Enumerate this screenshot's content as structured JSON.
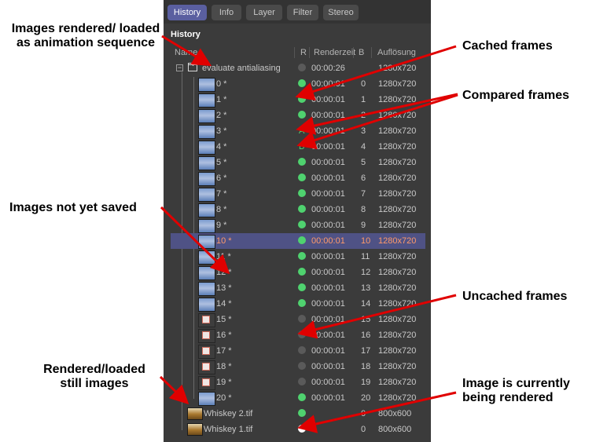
{
  "tabs": [
    {
      "label": "History",
      "active": true
    },
    {
      "label": "Info",
      "active": false
    },
    {
      "label": "Layer",
      "active": false
    },
    {
      "label": "Filter",
      "active": false
    },
    {
      "label": "Stereo",
      "active": false
    }
  ],
  "panel_title": "History",
  "columns": {
    "name": "Name",
    "r": "R",
    "renderzeit": "Renderzeit",
    "b": "B",
    "aufloesung": "Auflösung"
  },
  "group": {
    "name": "evaluate antialiasing",
    "time": "00:00:26",
    "resolution": "1280x720"
  },
  "frames": [
    {
      "name": "0 *",
      "time": "00:00:01",
      "b": "0",
      "res": "1280x720",
      "status": "cached"
    },
    {
      "name": "1 *",
      "time": "00:00:01",
      "b": "1",
      "res": "1280x720",
      "status": "cached"
    },
    {
      "name": "2 *",
      "time": "00:00:01",
      "b": "2",
      "res": "1280x720",
      "status": "cached"
    },
    {
      "name": "3 *",
      "time": "00:00:01",
      "b": "3",
      "res": "1280x720",
      "status": "compare",
      "mark": "A"
    },
    {
      "name": "4 *",
      "time": "00:00:01",
      "b": "4",
      "res": "1280x720",
      "status": "compare",
      "mark": "B"
    },
    {
      "name": "5 *",
      "time": "00:00:01",
      "b": "5",
      "res": "1280x720",
      "status": "cached"
    },
    {
      "name": "6 *",
      "time": "00:00:01",
      "b": "6",
      "res": "1280x720",
      "status": "cached"
    },
    {
      "name": "7 *",
      "time": "00:00:01",
      "b": "7",
      "res": "1280x720",
      "status": "cached"
    },
    {
      "name": "8 *",
      "time": "00:00:01",
      "b": "8",
      "res": "1280x720",
      "status": "cached"
    },
    {
      "name": "9 *",
      "time": "00:00:01",
      "b": "9",
      "res": "1280x720",
      "status": "cached"
    },
    {
      "name": "10 *",
      "time": "00:00:01",
      "b": "10",
      "res": "1280x720",
      "status": "cached",
      "selected": true
    },
    {
      "name": "11 *",
      "time": "00:00:01",
      "b": "11",
      "res": "1280x720",
      "status": "cached"
    },
    {
      "name": "12 *",
      "time": "00:00:01",
      "b": "12",
      "res": "1280x720",
      "status": "cached"
    },
    {
      "name": "13 *",
      "time": "00:00:01",
      "b": "13",
      "res": "1280x720",
      "status": "cached"
    },
    {
      "name": "14 *",
      "time": "00:00:01",
      "b": "14",
      "res": "1280x720",
      "status": "cached"
    },
    {
      "name": "15 *",
      "time": "00:00:01",
      "b": "15",
      "res": "1280x720",
      "status": "uncached"
    },
    {
      "name": "16 *",
      "time": "00:00:01",
      "b": "16",
      "res": "1280x720",
      "status": "uncached"
    },
    {
      "name": "17 *",
      "time": "00:00:01",
      "b": "17",
      "res": "1280x720",
      "status": "uncached"
    },
    {
      "name": "18 *",
      "time": "00:00:01",
      "b": "18",
      "res": "1280x720",
      "status": "uncached"
    },
    {
      "name": "19 *",
      "time": "00:00:01",
      "b": "19",
      "res": "1280x720",
      "status": "uncached"
    },
    {
      "name": "20 *",
      "time": "00:00:01",
      "b": "20",
      "res": "1280x720",
      "status": "cached"
    }
  ],
  "stills": [
    {
      "name": "Whiskey 2.tif",
      "time": "",
      "b": "0",
      "res": "800x600",
      "status": "cached"
    },
    {
      "name": "Whiskey 1.tif",
      "time": "",
      "b": "0",
      "res": "800x600",
      "status": "rendering"
    }
  ],
  "annotations": {
    "images_rendered": "Images rendered/ loaded as animation sequence",
    "cached_frames": "Cached frames",
    "compared_frames": "Compared frames",
    "not_saved": "Images not yet saved",
    "uncached_frames": "Uncached frames",
    "still_images": "Rendered/loaded still images",
    "being_rendered": "Image is currently being rendered"
  },
  "colors": {
    "accent": "#5a5fa0",
    "cached": "#4fd26f",
    "uncached": "#5a5a5a",
    "selected_text": "#ff9a6a",
    "arrow": "#e00000"
  }
}
